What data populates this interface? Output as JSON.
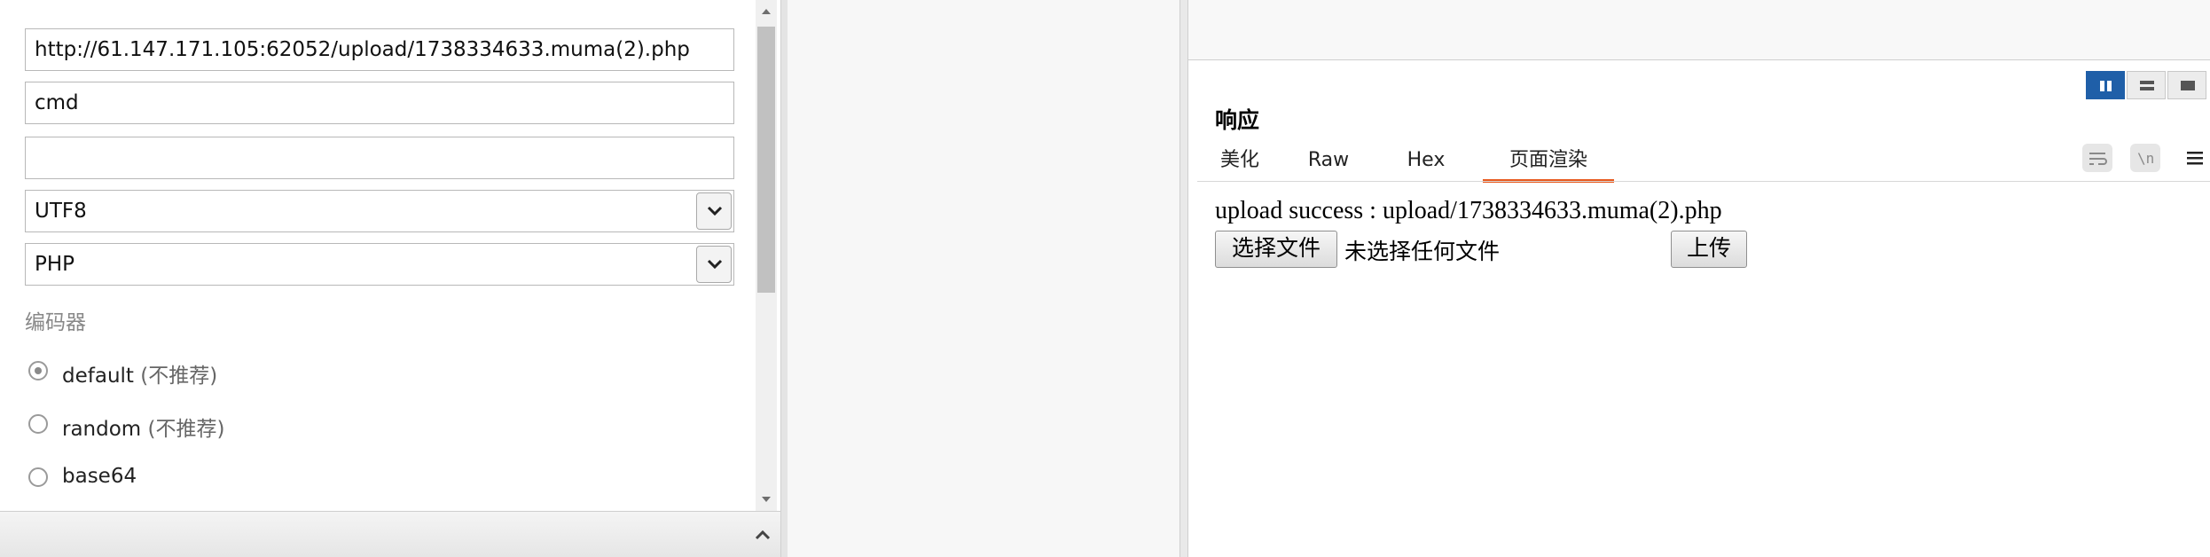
{
  "form": {
    "url_value": "http://61.147.171.105:62052/upload/1738334633.muma(2).php",
    "password_value": "cmd",
    "third_value": "",
    "encoding_selected": "UTF8",
    "type_selected": "PHP",
    "encoder_label": "编码器",
    "encoders": [
      {
        "name": "default",
        "note": "(不推荐)",
        "checked": true
      },
      {
        "name": "random",
        "note": "(不推荐)",
        "checked": false
      },
      {
        "name": "base64",
        "note": "",
        "checked": false
      }
    ]
  },
  "response": {
    "title": "响应",
    "tabs": [
      "美化",
      "Raw",
      "Hex",
      "页面渲染"
    ],
    "active_tab": "页面渲染",
    "rendered": {
      "message": "upload success : upload/1738334633.muma(2).php",
      "choose_file_label": "选择文件",
      "no_file_label": "未选择任何文件",
      "upload_label": "上传"
    },
    "view_toggle_active": "split-horizontal",
    "accent_color": "#e8591d",
    "toggle_active_color": "#1f5fa8"
  }
}
